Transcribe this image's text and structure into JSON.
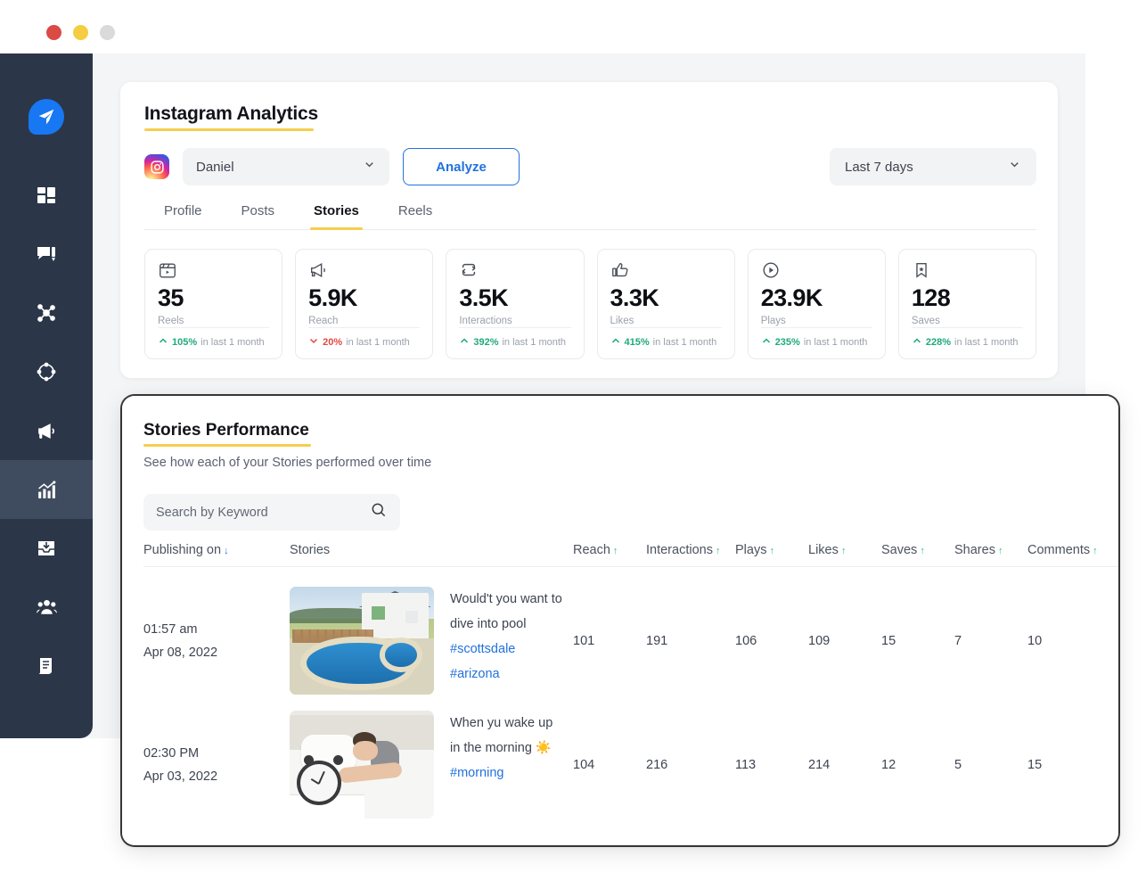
{
  "window": {
    "dots": [
      "close",
      "minimize",
      "maximize"
    ]
  },
  "sidebar": {
    "items": [
      {
        "name": "logo",
        "icon": "paper-plane-icon",
        "active": false
      },
      {
        "name": "dashboard",
        "icon": "grid-dashboard-icon",
        "active": false
      },
      {
        "name": "compose",
        "icon": "chat-compose-icon",
        "active": false
      },
      {
        "name": "network",
        "icon": "network-share-icon",
        "active": false
      },
      {
        "name": "discovery",
        "icon": "orbit-circle-icon",
        "active": false
      },
      {
        "name": "campaigns",
        "icon": "megaphone-icon",
        "active": false
      },
      {
        "name": "analytics",
        "icon": "bar-chart-trend-icon",
        "active": true
      },
      {
        "name": "inbox",
        "icon": "inbox-download-icon",
        "active": false
      },
      {
        "name": "team",
        "icon": "people-group-icon",
        "active": false
      },
      {
        "name": "reports",
        "icon": "document-report-icon",
        "active": false
      }
    ]
  },
  "analytics": {
    "title": "Instagram Analytics",
    "account": {
      "value": "Daniel",
      "icon": "instagram-logo-icon"
    },
    "analyze_label": "Analyze",
    "date_range": {
      "value": "Last 7 days"
    },
    "tabs": [
      {
        "label": "Profile",
        "active": false
      },
      {
        "label": "Posts",
        "active": false
      },
      {
        "label": "Stories",
        "active": true
      },
      {
        "label": "Reels",
        "active": false
      }
    ],
    "metrics": [
      {
        "icon": "film-clapper-icon",
        "value": "35",
        "label": "Reels",
        "delta": "105%",
        "delta_suffix": "in last 1 month",
        "direction": "up"
      },
      {
        "icon": "megaphone-icon",
        "value": "5.9K",
        "label": "Reach",
        "delta": "20%",
        "delta_suffix": "in last 1 month",
        "direction": "down"
      },
      {
        "icon": "repeat-loop-icon",
        "value": "3.5K",
        "label": "Interactions",
        "delta": "392%",
        "delta_suffix": "in last 1 month",
        "direction": "up"
      },
      {
        "icon": "thumbs-up-icon",
        "value": "3.3K",
        "label": "Likes",
        "delta": "415%",
        "delta_suffix": "in last 1 month",
        "direction": "up"
      },
      {
        "icon": "play-circle-icon",
        "value": "23.9K",
        "label": "Plays",
        "delta": "235%",
        "delta_suffix": "in last 1 month",
        "direction": "up"
      },
      {
        "icon": "bookmark-star-icon",
        "value": "128",
        "label": "Saves",
        "delta": "228%",
        "delta_suffix": "in last 1 month",
        "direction": "up"
      }
    ]
  },
  "stories_performance": {
    "title": "Stories Performance",
    "subtitle": "See how each of your Stories performed over time",
    "search": {
      "placeholder": "Search by Keyword",
      "value": "",
      "icon": "search-icon"
    },
    "columns": [
      {
        "label": "Publishing on",
        "sort": "down",
        "sort_color": "#2272DD"
      },
      {
        "label": "Stories",
        "sort": "none"
      },
      {
        "label": "Reach",
        "sort": "up"
      },
      {
        "label": "Interactions",
        "sort": "up"
      },
      {
        "label": "Plays",
        "sort": "up"
      },
      {
        "label": "Likes",
        "sort": "up"
      },
      {
        "label": "Saves",
        "sort": "up"
      },
      {
        "label": "Shares",
        "sort": "up"
      },
      {
        "label": "Comments",
        "sort": "up"
      }
    ],
    "rows": [
      {
        "time": "01:57 am",
        "date": "Apr 08, 2022",
        "thumb": "pool-house-photo",
        "caption": "Would't you want to dive into pool",
        "tags": [
          "#scottsdale",
          "#arizona"
        ],
        "reach": "101",
        "interactions": "191",
        "plays": "106",
        "likes": "109",
        "saves": "15",
        "shares": "7",
        "comments": "10"
      },
      {
        "time": "02:30 PM",
        "date": "Apr 03, 2022",
        "thumb": "man-sleeping-alarm-clock-photo",
        "caption": "When yu wake up in the morning ☀️",
        "tags": [
          "#morning"
        ],
        "reach": "104",
        "interactions": "216",
        "plays": "113",
        "likes": "214",
        "saves": "12",
        "shares": "5",
        "comments": "15"
      }
    ]
  },
  "colors": {
    "accent_yellow": "#F6CE4E",
    "accent_blue": "#2272DD",
    "positive_green": "#1EA97C",
    "negative_red": "#E14942",
    "sidebar_bg": "#2b3648",
    "page_bg": "#f4f5f6"
  }
}
